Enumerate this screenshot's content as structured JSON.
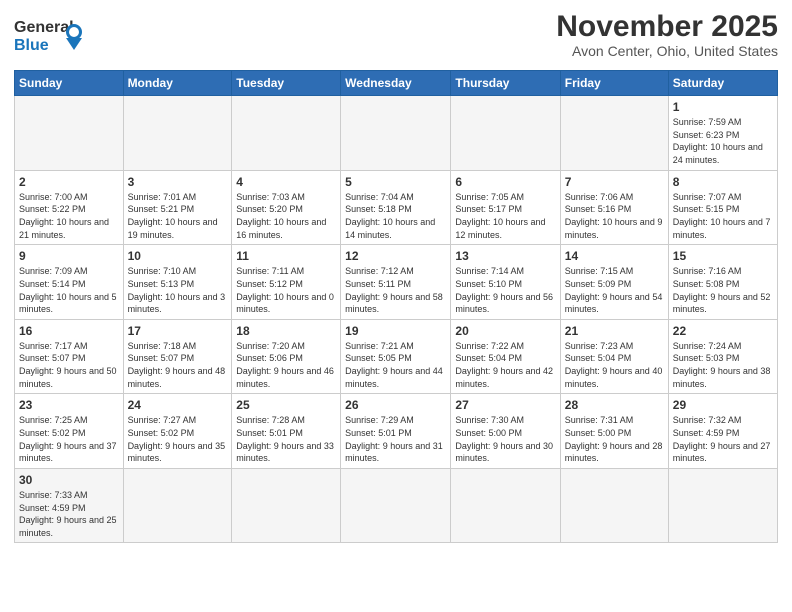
{
  "header": {
    "logo": {
      "part1": "General",
      "part2": "Blue"
    },
    "title": "November 2025",
    "location": "Avon Center, Ohio, United States"
  },
  "weekdays": [
    "Sunday",
    "Monday",
    "Tuesday",
    "Wednesday",
    "Thursday",
    "Friday",
    "Saturday"
  ],
  "weeks": [
    [
      null,
      null,
      null,
      null,
      null,
      null,
      {
        "day": "1",
        "sunrise": "Sunrise: 7:59 AM",
        "sunset": "Sunset: 6:23 PM",
        "daylight": "Daylight: 10 hours and 24 minutes."
      }
    ],
    [
      {
        "day": "2",
        "sunrise": "Sunrise: 7:00 AM",
        "sunset": "Sunset: 5:22 PM",
        "daylight": "Daylight: 10 hours and 21 minutes."
      },
      {
        "day": "3",
        "sunrise": "Sunrise: 7:01 AM",
        "sunset": "Sunset: 5:21 PM",
        "daylight": "Daylight: 10 hours and 19 minutes."
      },
      {
        "day": "4",
        "sunrise": "Sunrise: 7:03 AM",
        "sunset": "Sunset: 5:20 PM",
        "daylight": "Daylight: 10 hours and 16 minutes."
      },
      {
        "day": "5",
        "sunrise": "Sunrise: 7:04 AM",
        "sunset": "Sunset: 5:18 PM",
        "daylight": "Daylight: 10 hours and 14 minutes."
      },
      {
        "day": "6",
        "sunrise": "Sunrise: 7:05 AM",
        "sunset": "Sunset: 5:17 PM",
        "daylight": "Daylight: 10 hours and 12 minutes."
      },
      {
        "day": "7",
        "sunrise": "Sunrise: 7:06 AM",
        "sunset": "Sunset: 5:16 PM",
        "daylight": "Daylight: 10 hours and 9 minutes."
      },
      {
        "day": "8",
        "sunrise": "Sunrise: 7:07 AM",
        "sunset": "Sunset: 5:15 PM",
        "daylight": "Daylight: 10 hours and 7 minutes."
      }
    ],
    [
      {
        "day": "9",
        "sunrise": "Sunrise: 7:09 AM",
        "sunset": "Sunset: 5:14 PM",
        "daylight": "Daylight: 10 hours and 5 minutes."
      },
      {
        "day": "10",
        "sunrise": "Sunrise: 7:10 AM",
        "sunset": "Sunset: 5:13 PM",
        "daylight": "Daylight: 10 hours and 3 minutes."
      },
      {
        "day": "11",
        "sunrise": "Sunrise: 7:11 AM",
        "sunset": "Sunset: 5:12 PM",
        "daylight": "Daylight: 10 hours and 0 minutes."
      },
      {
        "day": "12",
        "sunrise": "Sunrise: 7:12 AM",
        "sunset": "Sunset: 5:11 PM",
        "daylight": "Daylight: 9 hours and 58 minutes."
      },
      {
        "day": "13",
        "sunrise": "Sunrise: 7:14 AM",
        "sunset": "Sunset: 5:10 PM",
        "daylight": "Daylight: 9 hours and 56 minutes."
      },
      {
        "day": "14",
        "sunrise": "Sunrise: 7:15 AM",
        "sunset": "Sunset: 5:09 PM",
        "daylight": "Daylight: 9 hours and 54 minutes."
      },
      {
        "day": "15",
        "sunrise": "Sunrise: 7:16 AM",
        "sunset": "Sunset: 5:08 PM",
        "daylight": "Daylight: 9 hours and 52 minutes."
      }
    ],
    [
      {
        "day": "16",
        "sunrise": "Sunrise: 7:17 AM",
        "sunset": "Sunset: 5:07 PM",
        "daylight": "Daylight: 9 hours and 50 minutes."
      },
      {
        "day": "17",
        "sunrise": "Sunrise: 7:18 AM",
        "sunset": "Sunset: 5:07 PM",
        "daylight": "Daylight: 9 hours and 48 minutes."
      },
      {
        "day": "18",
        "sunrise": "Sunrise: 7:20 AM",
        "sunset": "Sunset: 5:06 PM",
        "daylight": "Daylight: 9 hours and 46 minutes."
      },
      {
        "day": "19",
        "sunrise": "Sunrise: 7:21 AM",
        "sunset": "Sunset: 5:05 PM",
        "daylight": "Daylight: 9 hours and 44 minutes."
      },
      {
        "day": "20",
        "sunrise": "Sunrise: 7:22 AM",
        "sunset": "Sunset: 5:04 PM",
        "daylight": "Daylight: 9 hours and 42 minutes."
      },
      {
        "day": "21",
        "sunrise": "Sunrise: 7:23 AM",
        "sunset": "Sunset: 5:04 PM",
        "daylight": "Daylight: 9 hours and 40 minutes."
      },
      {
        "day": "22",
        "sunrise": "Sunrise: 7:24 AM",
        "sunset": "Sunset: 5:03 PM",
        "daylight": "Daylight: 9 hours and 38 minutes."
      }
    ],
    [
      {
        "day": "23",
        "sunrise": "Sunrise: 7:25 AM",
        "sunset": "Sunset: 5:02 PM",
        "daylight": "Daylight: 9 hours and 37 minutes."
      },
      {
        "day": "24",
        "sunrise": "Sunrise: 7:27 AM",
        "sunset": "Sunset: 5:02 PM",
        "daylight": "Daylight: 9 hours and 35 minutes."
      },
      {
        "day": "25",
        "sunrise": "Sunrise: 7:28 AM",
        "sunset": "Sunset: 5:01 PM",
        "daylight": "Daylight: 9 hours and 33 minutes."
      },
      {
        "day": "26",
        "sunrise": "Sunrise: 7:29 AM",
        "sunset": "Sunset: 5:01 PM",
        "daylight": "Daylight: 9 hours and 31 minutes."
      },
      {
        "day": "27",
        "sunrise": "Sunrise: 7:30 AM",
        "sunset": "Sunset: 5:00 PM",
        "daylight": "Daylight: 9 hours and 30 minutes."
      },
      {
        "day": "28",
        "sunrise": "Sunrise: 7:31 AM",
        "sunset": "Sunset: 5:00 PM",
        "daylight": "Daylight: 9 hours and 28 minutes."
      },
      {
        "day": "29",
        "sunrise": "Sunrise: 7:32 AM",
        "sunset": "Sunset: 4:59 PM",
        "daylight": "Daylight: 9 hours and 27 minutes."
      }
    ],
    [
      {
        "day": "30",
        "sunrise": "Sunrise: 7:33 AM",
        "sunset": "Sunset: 4:59 PM",
        "daylight": "Daylight: 9 hours and 25 minutes."
      },
      null,
      null,
      null,
      null,
      null,
      null
    ]
  ]
}
